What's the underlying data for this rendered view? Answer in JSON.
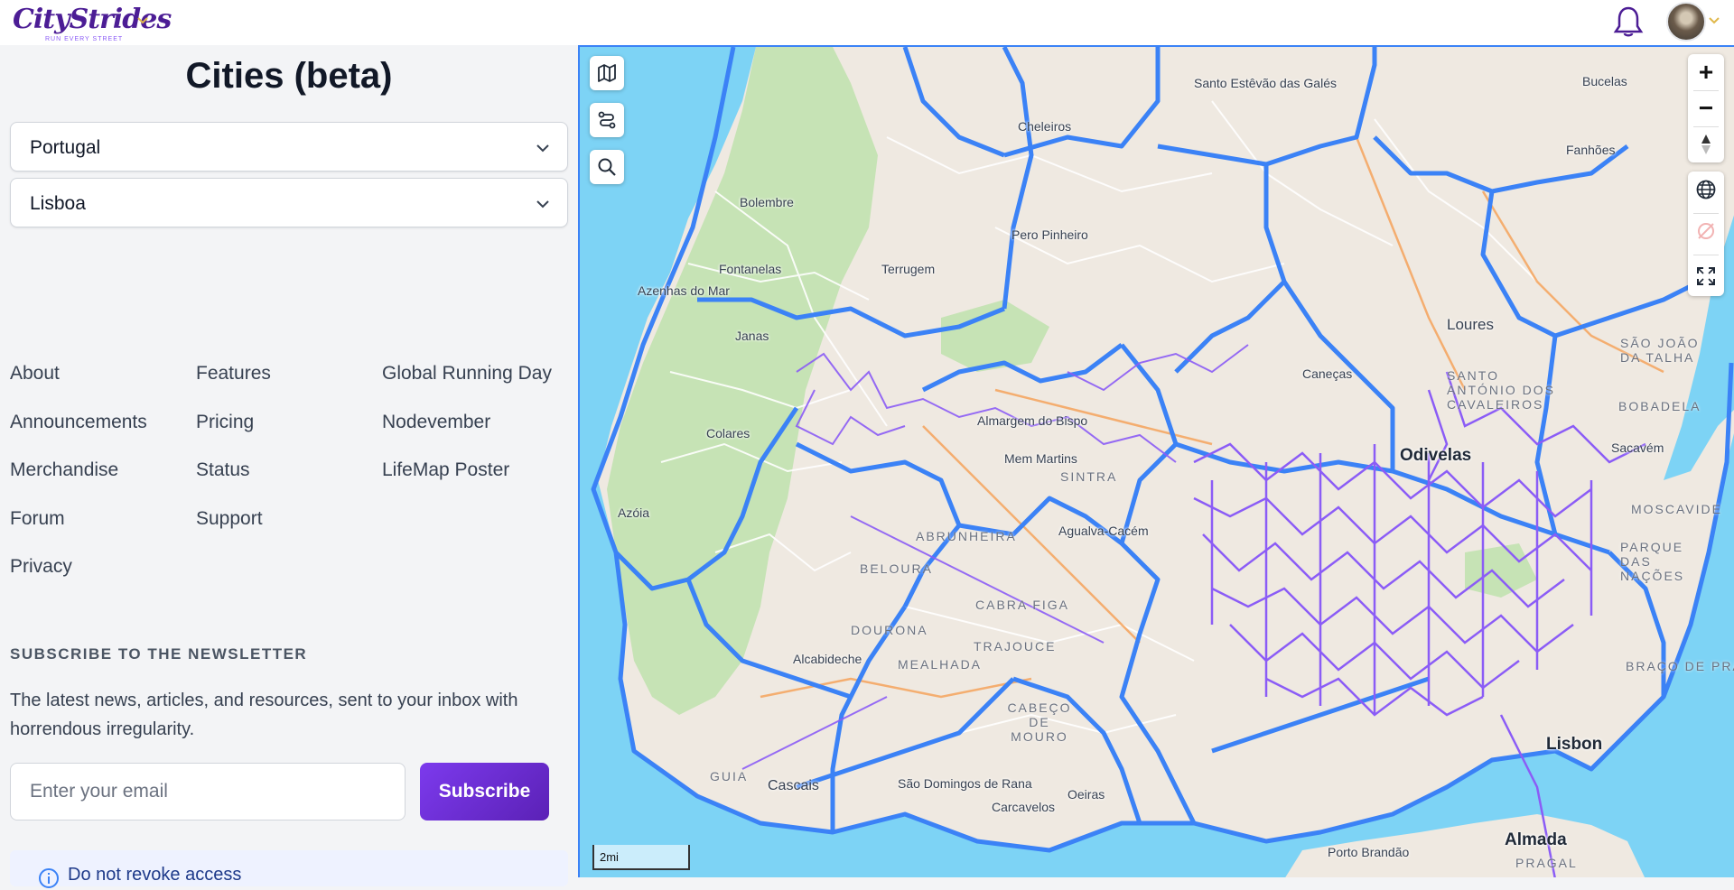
{
  "header": {
    "brand_script": "CityStrides",
    "brand_tagline": "RUN EVERY STREET"
  },
  "page": {
    "title": "Cities (beta)"
  },
  "filters": {
    "country": "Portugal",
    "city": "Lisboa"
  },
  "footer_links": {
    "col1": [
      "About",
      "Announcements",
      "Merchandise",
      "Forum",
      "Privacy"
    ],
    "col2": [
      "Features",
      "Pricing",
      "Status",
      "Support"
    ],
    "col3": [
      "Global Running Day",
      "Nodevember",
      "LifeMap Poster"
    ]
  },
  "newsletter": {
    "heading": "SUBSCRIBE TO THE NEWSLETTER",
    "text": "The latest news, articles, and resources, sent to your inbox with horrendous irregularity.",
    "email_placeholder": "Enter your email",
    "subscribe_label": "Subscribe"
  },
  "notice": {
    "text": "Do not revoke access"
  },
  "map": {
    "scale_label": "2mi",
    "zoom_in": "+",
    "zoom_out": "−",
    "places": [
      "Santo Estêvão das Galés",
      "Bucelas",
      "Cheleiros",
      "Fanhões",
      "Bolembre",
      "Pero Pinheiro",
      "Fontanelas",
      "Terrugem",
      "Azenhas do Mar",
      "Janas",
      "Loures",
      "Caneças",
      "Colares",
      "Almargem do Bispo",
      "Odivelas",
      "Sacavém",
      "Azóia",
      "Agualva-Cacém",
      "Alcabideche",
      "Mem Martins",
      "São Domingos de Rana",
      "Carcavelos",
      "Oeiras",
      "Cascais",
      "Almada",
      "Porto Brandão",
      "Lisbon"
    ],
    "areas": [
      "SÃO JOÃO DA TALHA",
      "SANTO ANTÓNIO DOS CAVALEIROS",
      "BOBADELA",
      "ABRUNHEIRA",
      "BELOURA",
      "CABRA FIGA",
      "DOURONA",
      "TRAJOUCE",
      "MEALHADA",
      "CABEÇO DE MOURO",
      "GUIA",
      "SINTRA",
      "PRAGAL",
      "PARQUE DAS NAÇÕES",
      "BRAÇO DE PRATA",
      "MOSCAVIDE"
    ]
  },
  "colors": {
    "accent": "#7c3aed",
    "boundary": "#3b82f6",
    "activity": "#8b5cf6",
    "water": "#7dd3f5",
    "park": "#c6e3b5"
  }
}
